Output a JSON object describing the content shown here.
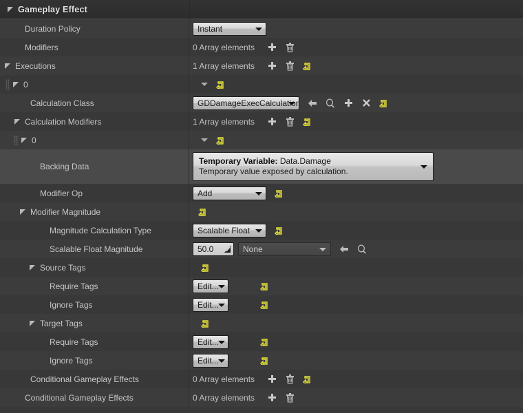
{
  "header": {
    "title": "Gameplay Effect",
    "expander": "expander-triangle-icon"
  },
  "rows": {
    "duration_policy": {
      "label": "Duration Policy",
      "value": "Instant"
    },
    "modifiers": {
      "label": "Modifiers",
      "value": "0 Array elements"
    },
    "executions": {
      "label": "Executions",
      "value": "1 Array elements"
    },
    "executions_index": {
      "label": "0"
    },
    "calculation_class": {
      "label": "Calculation Class",
      "value": "GDDamageExecCalculation"
    },
    "calculation_modifiers": {
      "label": "Calculation Modifiers",
      "value": "1 Array elements"
    },
    "calc_mod_index": {
      "label": "0"
    },
    "backing_data": {
      "label": "Backing Data",
      "value_title_prefix": "Temporary Variable:",
      "value_title": " Data.Damage",
      "value_subtitle": "Temporary value exposed by calculation."
    },
    "modifier_op": {
      "label": "Modifier Op",
      "value": "Add"
    },
    "modifier_magnitude": {
      "label": "Modifier Magnitude"
    },
    "magnitude_calculation_type": {
      "label": "Magnitude Calculation Type",
      "value": "Scalable Float"
    },
    "scalable_float_magnitude": {
      "label": "Scalable Float Magnitude",
      "number": "50.0",
      "asset": "None"
    },
    "source_tags": {
      "label": "Source Tags"
    },
    "source_require_tags": {
      "label": "Require Tags",
      "value": "Edit..."
    },
    "source_ignore_tags": {
      "label": "Ignore Tags",
      "value": "Edit..."
    },
    "target_tags": {
      "label": "Target Tags"
    },
    "target_require_tags": {
      "label": "Require Tags",
      "value": "Edit..."
    },
    "target_ignore_tags": {
      "label": "Ignore Tags",
      "value": "Edit..."
    },
    "conditional_gameplay_effects_inner": {
      "label": "Conditional Gameplay Effects",
      "value": "0 Array elements"
    },
    "conditional_gameplay_effects_outer": {
      "label": "Conditional Gameplay Effects",
      "value": "0 Array elements"
    }
  },
  "icons": {
    "add": "plus-icon",
    "delete": "trash-icon",
    "reset": "reset-to-default-icon",
    "browse": "browse-back-arrow-icon",
    "search": "magnifier-icon",
    "clear": "clear-x-icon",
    "caret": "chevron-down-icon",
    "drag": "drag-handle-icon",
    "spinner": "spinner-drag-icon"
  },
  "colors": {
    "background": "#383838",
    "row_alt": "#3c3c3c",
    "row_highlight": "#4a4a4a",
    "header": "#2f2f2f",
    "text": "#c6c6c6",
    "reset_yellow": "#e8e438",
    "combo_light": "#d6d6d6"
  }
}
